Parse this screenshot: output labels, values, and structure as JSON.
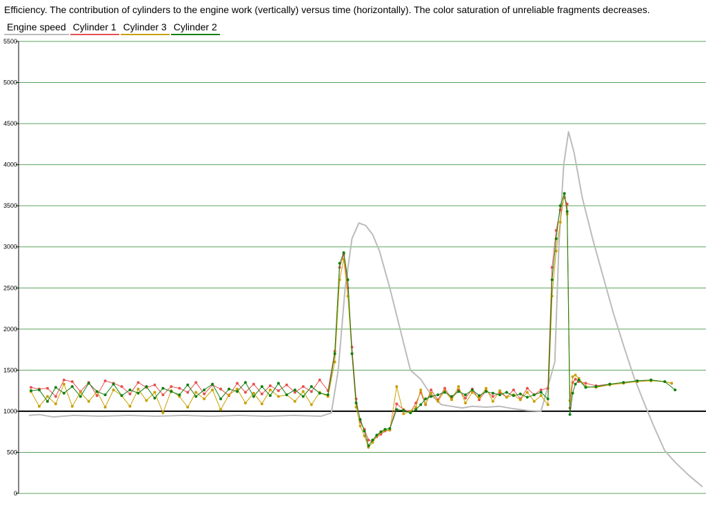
{
  "title": "Efficiency. The contribution of cylinders to the engine work (vertically) versus time (horizontally). The color saturation of unreliable fragments decreases.",
  "chart_data": {
    "type": "line",
    "ylim": [
      0,
      5500
    ],
    "xlim": [
      0,
      100
    ],
    "yticks": [
      0,
      500,
      1000,
      1500,
      2000,
      2500,
      3000,
      3500,
      4000,
      4500,
      5000,
      5500
    ],
    "ytick_labels": [
      "0",
      "500",
      "1000",
      "1500",
      "2000",
      "2500",
      "3000",
      "3500",
      "4000",
      "4500",
      "5000",
      "5500"
    ],
    "grid": true,
    "grid_color": "#5aa05a",
    "reference_line": 1000,
    "legend_position": "top-left",
    "series": [
      {
        "name": "Engine speed",
        "color": "#bbbbbb",
        "markers": false,
        "x": [
          1.5,
          3,
          5,
          8,
          12,
          16,
          20,
          24,
          28,
          32,
          36,
          40,
          44,
          45.5,
          46.5,
          47.5,
          48.5,
          49.5,
          50.5,
          51.5,
          52.5,
          54,
          55.5,
          57,
          58.5,
          60,
          61.5,
          63,
          64.5,
          66,
          68,
          70,
          72,
          74,
          76,
          78,
          78.6,
          79.3,
          80,
          80.8,
          82,
          83.5,
          85,
          86.5,
          88,
          89.5,
          91,
          92.5,
          94,
          95.5,
          97.5,
          99.5
        ],
        "y": [
          950,
          960,
          930,
          950,
          940,
          950,
          940,
          950,
          940,
          950,
          940,
          950,
          940,
          980,
          1500,
          2500,
          3100,
          3290,
          3260,
          3150,
          2950,
          2500,
          2000,
          1500,
          1390,
          1200,
          1080,
          1060,
          1040,
          1060,
          1050,
          1060,
          1030,
          1010,
          1000,
          1600,
          3000,
          4000,
          4400,
          4150,
          3600,
          3100,
          2650,
          2200,
          1800,
          1420,
          1100,
          800,
          520,
          380,
          220,
          80
        ]
      },
      {
        "name": "Cylinder 1",
        "color": "#e85050",
        "markers": true,
        "x": [
          1.8,
          3,
          4.2,
          5.4,
          6.6,
          7.8,
          9,
          10.2,
          11.4,
          12.6,
          13.8,
          15,
          16.2,
          17.4,
          18.6,
          19.8,
          21,
          22.2,
          23.4,
          24.6,
          25.8,
          27,
          28.2,
          29.4,
          30.6,
          31.8,
          33,
          34.2,
          35.4,
          36.6,
          37.8,
          39,
          40.2,
          41.4,
          42.6,
          43.8,
          45,
          46,
          46.7,
          47.3,
          47.9,
          48.5,
          49.1,
          49.7,
          50.3,
          50.9,
          51.5,
          52.1,
          52.7,
          53.3,
          54,
          55,
          56,
          57,
          57.8,
          58.5,
          59.2,
          60,
          61,
          62,
          63,
          64,
          65,
          66,
          67,
          68,
          69,
          70,
          71,
          72,
          73,
          74,
          75,
          76,
          77,
          77.6,
          78.2,
          78.8,
          79.4,
          79.8,
          80.2,
          80.6,
          81,
          81.5,
          82.5,
          84,
          86,
          88,
          90,
          92,
          94,
          95
        ],
        "y": [
          1290,
          1270,
          1280,
          1180,
          1380,
          1360,
          1240,
          1350,
          1190,
          1370,
          1340,
          1300,
          1210,
          1350,
          1290,
          1320,
          1200,
          1300,
          1280,
          1230,
          1350,
          1210,
          1320,
          1270,
          1190,
          1340,
          1230,
          1330,
          1210,
          1310,
          1250,
          1320,
          1230,
          1300,
          1240,
          1380,
          1250,
          1730,
          2750,
          2910,
          2500,
          1780,
          1150,
          870,
          780,
          650,
          630,
          690,
          720,
          760,
          770,
          1090,
          1020,
          990,
          1100,
          1230,
          1080,
          1260,
          1140,
          1280,
          1150,
          1260,
          1160,
          1270,
          1140,
          1250,
          1180,
          1230,
          1170,
          1260,
          1150,
          1280,
          1200,
          1260,
          1280,
          2750,
          3200,
          3450,
          3600,
          3520,
          1040,
          1350,
          1390,
          1360,
          1340,
          1310,
          1330,
          1350,
          1370,
          1380,
          1360,
          1340
        ]
      },
      {
        "name": "Cylinder 3",
        "color": "#c8a000",
        "markers": true,
        "x": [
          1.8,
          3,
          4.2,
          5.4,
          6.6,
          7.8,
          9,
          10.2,
          11.4,
          12.6,
          13.8,
          15,
          16.2,
          17.4,
          18.6,
          19.8,
          21,
          22.2,
          23.4,
          24.6,
          25.8,
          27,
          28.2,
          29.4,
          30.6,
          31.8,
          33,
          34.2,
          35.4,
          36.6,
          37.8,
          39,
          40.2,
          41.4,
          42.6,
          43.8,
          45,
          46,
          46.7,
          47.3,
          47.9,
          48.5,
          49.1,
          49.7,
          50.3,
          50.9,
          51.5,
          52.1,
          52.7,
          53.3,
          54,
          55,
          56,
          57,
          57.8,
          58.5,
          59.2,
          60,
          61,
          62,
          63,
          64,
          65,
          66,
          67,
          68,
          69,
          70,
          71,
          72,
          73,
          74,
          75,
          76,
          77,
          77.6,
          78.2,
          78.8,
          79.4,
          79.8,
          80.2,
          80.6,
          81,
          81.5,
          82.5,
          84,
          86,
          88,
          90,
          92,
          94,
          95
        ],
        "y": [
          1240,
          1060,
          1180,
          1090,
          1330,
          1060,
          1230,
          1120,
          1240,
          1050,
          1260,
          1190,
          1060,
          1270,
          1130,
          1230,
          980,
          1250,
          1180,
          1050,
          1230,
          1150,
          1260,
          1020,
          1200,
          1270,
          1100,
          1220,
          1090,
          1260,
          1180,
          1200,
          1120,
          1240,
          1080,
          1230,
          1180,
          1600,
          2600,
          2850,
          2400,
          1700,
          1050,
          820,
          700,
          560,
          620,
          700,
          740,
          770,
          770,
          1300,
          970,
          1000,
          1050,
          1260,
          1090,
          1220,
          1120,
          1250,
          1140,
          1300,
          1100,
          1230,
          1160,
          1280,
          1120,
          1250,
          1170,
          1200,
          1140,
          1230,
          1120,
          1190,
          1080,
          2400,
          2950,
          3300,
          3650,
          3400,
          1130,
          1420,
          1440,
          1400,
          1300,
          1290,
          1320,
          1340,
          1360,
          1370,
          1360,
          1340
        ]
      },
      {
        "name": "Cylinder 2",
        "color": "#108010",
        "markers": true,
        "x": [
          1.8,
          3,
          4.2,
          5.4,
          6.6,
          7.8,
          9,
          10.2,
          11.4,
          12.6,
          13.8,
          15,
          16.2,
          17.4,
          18.6,
          19.8,
          21,
          22.2,
          23.4,
          24.6,
          25.8,
          27,
          28.2,
          29.4,
          30.6,
          31.8,
          33,
          34.2,
          35.4,
          36.6,
          37.8,
          39,
          40.2,
          41.4,
          42.6,
          43.8,
          45,
          46,
          46.7,
          47.3,
          47.9,
          48.5,
          49.1,
          49.7,
          50.3,
          50.9,
          51.5,
          52.1,
          52.7,
          53.3,
          54,
          55,
          56,
          57,
          57.8,
          58.5,
          59.2,
          60,
          61,
          62,
          63,
          64,
          65,
          66,
          67,
          68,
          69,
          70,
          71,
          72,
          73,
          74,
          75,
          76,
          77,
          77.6,
          78.2,
          78.8,
          79.4,
          79.8,
          80.2,
          80.6,
          81,
          81.5,
          82.5,
          84,
          86,
          88,
          90,
          92,
          94,
          95.5
        ],
        "y": [
          1250,
          1260,
          1120,
          1290,
          1220,
          1300,
          1180,
          1340,
          1240,
          1200,
          1330,
          1190,
          1260,
          1220,
          1300,
          1160,
          1280,
          1240,
          1200,
          1320,
          1180,
          1260,
          1330,
          1150,
          1270,
          1240,
          1350,
          1180,
          1300,
          1190,
          1340,
          1200,
          1260,
          1180,
          1300,
          1220,
          1200,
          1700,
          2800,
          2930,
          2600,
          1700,
          1100,
          900,
          760,
          580,
          650,
          710,
          750,
          780,
          790,
          1020,
          1010,
          980,
          1020,
          1080,
          1150,
          1180,
          1200,
          1230,
          1180,
          1240,
          1200,
          1260,
          1190,
          1240,
          1220,
          1200,
          1230,
          1190,
          1210,
          1170,
          1200,
          1230,
          1150,
          2600,
          3100,
          3500,
          3650,
          3430,
          960,
          1220,
          1330,
          1380,
          1290,
          1300,
          1330,
          1350,
          1370,
          1380,
          1360,
          1260
        ]
      }
    ]
  }
}
